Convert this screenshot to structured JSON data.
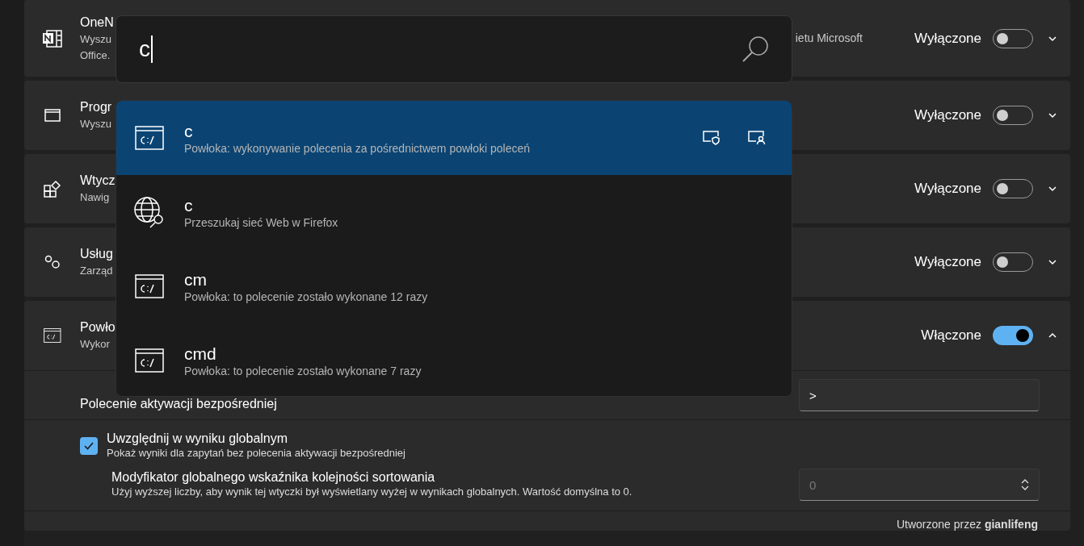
{
  "plugins": [
    {
      "kind": "onenote",
      "title": "OneN",
      "description_lines": [
        "Wyszu",
        "Office."
      ],
      "description_right": "ietu Microsoft",
      "status": "Wyłączone",
      "on": false,
      "expanded": false
    },
    {
      "kind": "window",
      "title": "Progr",
      "description_lines": [
        "Wyszu"
      ],
      "status": "Wyłączone",
      "on": false,
      "expanded": false
    },
    {
      "kind": "plugin",
      "title": "Wtycz",
      "description_lines": [
        "Nawig"
      ],
      "status": "Wyłączone",
      "on": false,
      "expanded": false
    },
    {
      "kind": "services",
      "title": "Usług",
      "description_lines": [
        "Zarząd"
      ],
      "status": "Wyłączone",
      "on": false,
      "expanded": false
    },
    {
      "kind": "shell",
      "title": "Powło",
      "description_lines": [
        "Wykor"
      ],
      "status": "Włączone",
      "on": true,
      "expanded": true
    }
  ],
  "settings": {
    "activation_label": "Polecenie aktywacji bezpośredniej",
    "activation_value": ">",
    "global_checkbox": {
      "label": "Uwzględnij w wyniku globalnym",
      "hint": "Pokaż wyniki dla zapytań bez polecenia aktywacji bezpośredniej",
      "checked": true
    },
    "modifier": {
      "label": "Modyfikator globalnego wskaźnika kolejności sortowania",
      "hint": "Użyj wyższej liczby, aby wynik tej wtyczki był wyświetlany wyżej w wynikach globalnych. Wartość domyślna to 0.",
      "placeholder": "0"
    },
    "author": "Utworzone przez **gianlifeng**"
  },
  "launcher": {
    "search": {
      "value": "c"
    },
    "results": [
      {
        "kind": "shell",
        "title": "c",
        "subtitle": "Powłoka: wykonywanie polecenia za pośrednictwem powłoki poleceń",
        "selected": true
      },
      {
        "kind": "web",
        "title": "c",
        "subtitle": "Przeszukaj sieć Web w Firefox",
        "selected": false
      },
      {
        "kind": "shell",
        "title": "cm",
        "subtitle": "Powłoka: to polecenie zostało wykonane 12 razy",
        "selected": false
      },
      {
        "kind": "shell",
        "title": "cmd",
        "subtitle": "Powłoka: to polecenie zostało wykonane 7 razy",
        "selected": false
      }
    ]
  }
}
